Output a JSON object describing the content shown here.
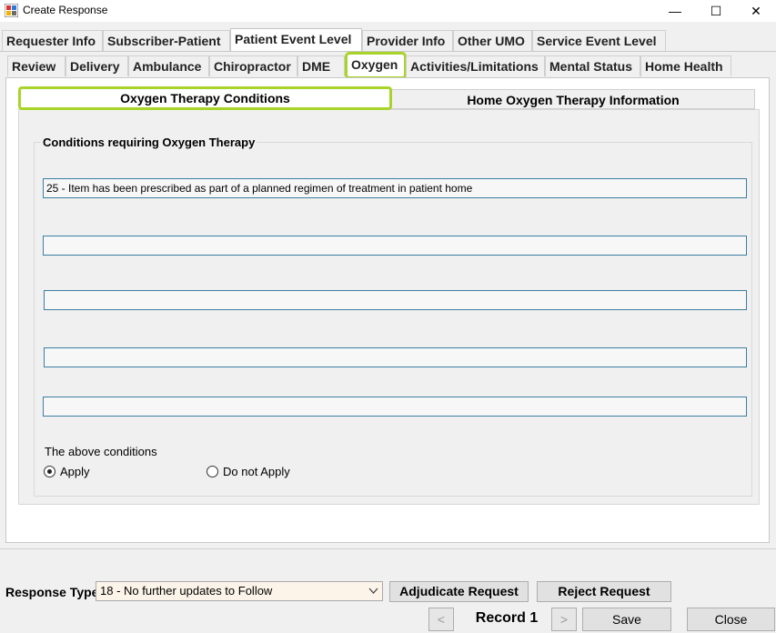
{
  "window": {
    "title": "Create Response",
    "minimize_glyph": "—",
    "maximize_glyph": "☐",
    "close_glyph": "✕"
  },
  "top_tabs": [
    {
      "label": "Requester Info"
    },
    {
      "label": "Subscriber-Patient"
    },
    {
      "label": "Patient Event Level"
    },
    {
      "label": "Provider Info"
    },
    {
      "label": "Other UMO"
    },
    {
      "label": "Service Event Level"
    }
  ],
  "sub_tabs": [
    {
      "label": "Review"
    },
    {
      "label": "Delivery"
    },
    {
      "label": "Ambulance"
    },
    {
      "label": "Chiropractor"
    },
    {
      "label": "DME"
    },
    {
      "label": "Oxygen"
    },
    {
      "label": "Activities/Limitations"
    },
    {
      "label": "Mental Status"
    },
    {
      "label": "Home Health"
    }
  ],
  "oxygen_tabs": [
    {
      "label": "Oxygen Therapy Conditions"
    },
    {
      "label": "Home Oxygen Therapy Information"
    }
  ],
  "conditions": {
    "group_title": "Conditions requiring Oxygen Therapy",
    "fields": [
      "25 - Item has been prescribed as part of a planned regimen of treatment in patient home",
      "",
      "",
      "",
      ""
    ],
    "above_label": "The above conditions",
    "apply_label": "Apply",
    "do_not_apply_label": "Do not Apply",
    "selected": "Apply"
  },
  "footer": {
    "response_type_label": "Response Type",
    "response_type_value": "18 - No further updates to Follow",
    "adjudicate_label": "Adjudicate Request",
    "reject_label": "Reject Request",
    "prev_glyph": "<",
    "next_glyph": ">",
    "record_label": "Record 1",
    "save_label": "Save",
    "close_label": "Close"
  },
  "colors": {
    "highlight": "#a8d42a",
    "field_border": "#3c7ea1",
    "select_bg": "#fcf4e9"
  }
}
